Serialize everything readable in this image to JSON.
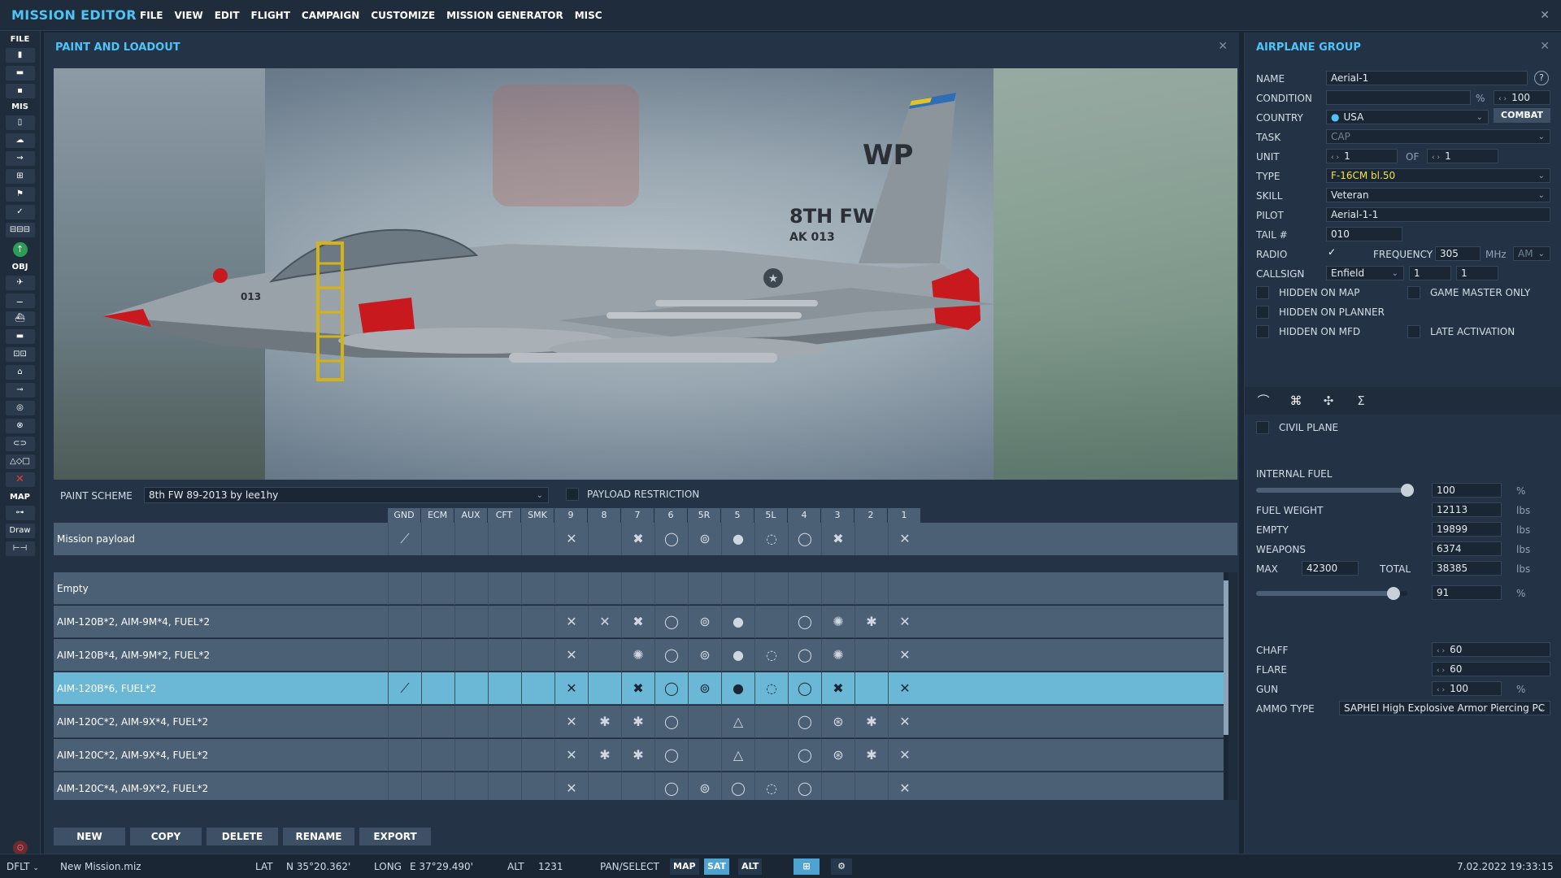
{
  "app": {
    "title": "MISSION EDITOR",
    "menu": [
      "FILE",
      "VIEW",
      "EDIT",
      "FLIGHT",
      "CAMPAIGN",
      "CUSTOMIZE",
      "MISSION GENERATOR",
      "MISC"
    ]
  },
  "toolbar": {
    "file_label": "FILE",
    "mis_label": "MIS",
    "obj_label": "OBJ",
    "map_label": "MAP",
    "draw_label": "Draw",
    "file_tools": [
      "new-mission-icon",
      "open-icon",
      "save-icon"
    ],
    "mis_tools": [
      "briefing-icon",
      "weather-icon",
      "triggers-icon",
      "resources-icon",
      "goals-icon",
      "check-icon",
      "layers-icon"
    ],
    "obj_tools": [
      "airplane-icon",
      "helicopter-icon",
      "ship-icon",
      "vehicle-icon",
      "static-icon",
      "zone-icon",
      "route-icon",
      "target-icon",
      "nav-point-icon",
      "group-icon",
      "template-icon",
      "delete-icon"
    ]
  },
  "loadout": {
    "title": "PAINT AND LOADOUT",
    "paint_scheme_label": "PAINT SCHEME",
    "paint_scheme_value": "8th FW 89-2013 by lee1hy",
    "payload_restriction_label": "PAYLOAD RESTRICTION",
    "aircraft_tail_text": "WP",
    "aircraft_wing_text": "8TH FW",
    "aircraft_serial_text": "AK 013",
    "aircraft_nose_text": "013",
    "station_headers": [
      "GND",
      "ECM",
      "AUX",
      "CFT",
      "SMK",
      "9",
      "8",
      "7",
      "6",
      "5R",
      "5",
      "5L",
      "4",
      "3",
      "2",
      "1"
    ],
    "mission_payload_label": "Mission payload",
    "payloads": [
      {
        "name": "Empty",
        "selected": false,
        "icons": {}
      },
      {
        "name": "AIM-120B*2, AIM-9M*4, FUEL*2",
        "selected": false,
        "icons": {
          "9": "✕",
          "8": "✕",
          "7": "✖",
          "6": "◯",
          "5R": "⊚",
          "5": "●",
          "4": "◯",
          "3": "✺",
          "2": "✱",
          "1": "✕"
        }
      },
      {
        "name": "AIM-120B*4, AIM-9M*2, FUEL*2",
        "selected": false,
        "icons": {
          "9": "✕",
          "7": "✺",
          "6": "◯",
          "5R": "⊚",
          "5": "●",
          "5L": "◌",
          "4": "◯",
          "3": "✺",
          "1": "✕"
        }
      },
      {
        "name": "AIM-120B*6, FUEL*2",
        "selected": true,
        "icons": {
          "GND": "⟋",
          "9": "✕",
          "7": "✖",
          "6": "◯",
          "5R": "⊚",
          "5": "●",
          "5L": "◌",
          "4": "◯",
          "3": "✖",
          "1": "✕"
        }
      },
      {
        "name": "AIM-120C*2, AIM-9X*4, FUEL*2",
        "selected": false,
        "icons": {
          "9": "✕",
          "8": "✱",
          "7": "✱",
          "6": "◯",
          "5": "△",
          "4": "◯",
          "3": "⊛",
          "2": "✱",
          "1": "✕"
        }
      },
      {
        "name": "AIM-120C*2, AIM-9X*4, FUEL*2",
        "selected": false,
        "icons": {
          "9": "✕",
          "8": "✱",
          "7": "✱",
          "6": "◯",
          "5": "△",
          "4": "◯",
          "3": "⊛",
          "2": "✱",
          "1": "✕"
        }
      },
      {
        "name": "AIM-120C*4, AIM-9X*2, FUEL*2",
        "selected": false,
        "icons": {
          "9": "✕",
          "6": "◯",
          "5R": "⊚",
          "5": "◯",
          "5L": "◌",
          "4": "◯",
          "1": "✕"
        }
      }
    ],
    "mission_icons": {
      "GND": "⟋",
      "9": "✕",
      "7": "✖",
      "6": "◯",
      "5R": "⊚",
      "5": "●",
      "5L": "◌",
      "4": "◯",
      "3": "✖",
      "1": "✕"
    },
    "buttons": [
      "NEW",
      "COPY",
      "DELETE",
      "RENAME",
      "EXPORT"
    ]
  },
  "group": {
    "title": "AIRPLANE GROUP",
    "help": "?",
    "name_label": "NAME",
    "name_value": "Aerial-1",
    "condition_label": "CONDITION",
    "condition_unit": "%",
    "condition_value": "100",
    "country_label": "COUNTRY",
    "country_value": "USA",
    "combat_button": "COMBAT",
    "task_label": "TASK",
    "task_value": "CAP",
    "unit_label": "UNIT",
    "unit_value": "1",
    "unit_of": "OF",
    "unit_total": "1",
    "type_label": "TYPE",
    "type_value": "F-16CM bl.50",
    "skill_label": "SKILL",
    "skill_value": "Veteran",
    "pilot_label": "PILOT",
    "pilot_value": "Aerial-1-1",
    "tail_label": "TAIL #",
    "tail_value": "010",
    "radio_label": "RADIO",
    "frequency_label": "FREQUENCY",
    "frequency_value": "305",
    "frequency_unit": "MHz",
    "modulation_value": "AM",
    "callsign_label": "CALLSIGN",
    "callsign_value": "Enfield",
    "callsign_num1": "1",
    "callsign_num2": "1",
    "hidden_on_map": "HIDDEN ON MAP",
    "game_master_only": "GAME MASTER ONLY",
    "hidden_on_planner": "HIDDEN ON PLANNER",
    "hidden_on_mfd": "HIDDEN ON MFD",
    "late_activation": "LATE ACTIVATION",
    "civil_plane": "CIVIL PLANE",
    "internal_fuel_label": "INTERNAL FUEL",
    "internal_fuel_value": "100",
    "pct": "%",
    "internal_fuel_fraction": 1.0,
    "fuel_weight_label": "FUEL WEIGHT",
    "fuel_weight_value": "12113",
    "empty_label": "EMPTY",
    "empty_value": "19899",
    "weapons_label": "WEAPONS",
    "weapons_value": "6374",
    "max_label": "MAX",
    "max_value": "42300",
    "total_label": "TOTAL",
    "total_value": "38385",
    "total_pct_value": "91",
    "total_fraction": 0.91,
    "lbs": "lbs",
    "chaff_label": "CHAFF",
    "chaff_value": "60",
    "flare_label": "FLARE",
    "flare_value": "60",
    "gun_label": "GUN",
    "gun_value": "100",
    "ammo_type_label": "AMMO TYPE",
    "ammo_type_value": "SAPHEI High Explosive Armor Piercing PC"
  },
  "statusbar": {
    "profile": "DFLT",
    "mission_file": "New Mission.miz",
    "lat_label": "LAT",
    "lat_value": "N 35°20.362'",
    "long_label": "LONG",
    "long_value": "E 37°29.490'",
    "alt_label": "ALT",
    "alt_value": "1231",
    "mode": "PAN/SELECT",
    "map_btn": "MAP",
    "sat_btn": "SAT",
    "alt_btn": "ALT",
    "datetime": "7.02.2022 19:33:15"
  },
  "colors": {
    "accent": "#4fc3f7",
    "selected_row": "#6ab8d6",
    "panel": "#243446",
    "type_text": "#f2e24b"
  }
}
